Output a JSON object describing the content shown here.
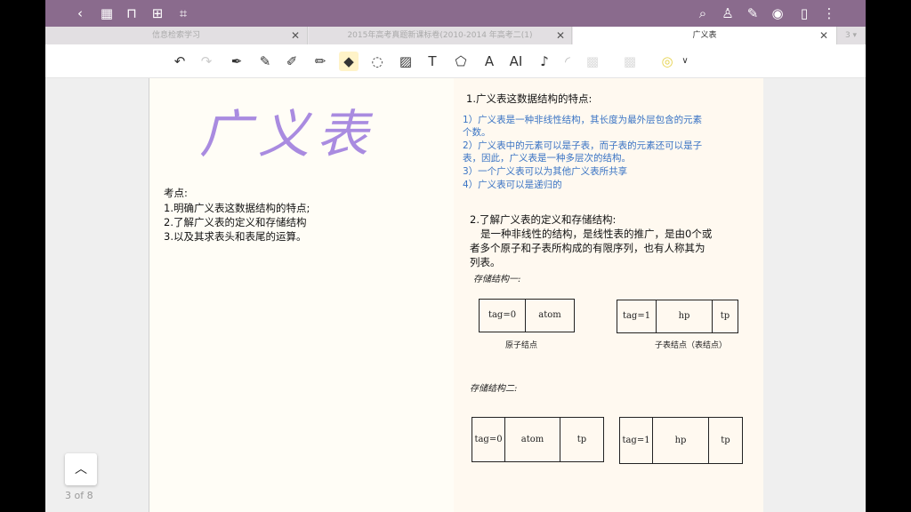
{
  "tabs": [
    {
      "label": "信息检索学习"
    },
    {
      "label": "2015年高考真题新课标卷(2010-2014 年高考二(1)"
    },
    {
      "label": "广义表"
    },
    {
      "label": "3"
    }
  ],
  "page_indicator": "3 of 8",
  "left_page": {
    "handwritten_title": "广义表",
    "notes_heading": "考点:",
    "notes": [
      "1.明确广义表这数据结构的特点;",
      "2.了解广义表的定义和存储结构",
      "3.以及其求表头和表尾的运算。"
    ]
  },
  "right_page": {
    "section1_title": "1.广义表这数据结构的特点:",
    "points": [
      "1）广义表是一种非线性结构，其长度为最外层包含的元素",
      "个数。",
      "2）广义表中的元素可以是子表，而子表的元素还可以是子",
      "表，因此，广义表是一种多层次的结构。",
      "3）一个广义表可以为其他广义表所共享",
      "4）广义表可以是递归的"
    ],
    "section2_title": "2.了解广义表的定义和存储结构:",
    "definition": [
      "是一种非线性的结构，是线性表的推广，是由0个或",
      "者多个原子和子表所构成的有限序列，也有人称其为",
      "列表。"
    ],
    "storage1_label": "存储结构一:",
    "storage1_atom_cells": [
      "tag=0",
      "atom"
    ],
    "storage1_atom_caption": "原子结点",
    "storage1_sub_cells": [
      "tag=1",
      "hp",
      "tp"
    ],
    "storage1_sub_caption": "子表结点（表结点）",
    "storage2_label": "存储结构二:",
    "storage2_atom_cells": [
      "tag=0",
      "atom",
      "tp"
    ],
    "storage2_sub_cells": [
      "tag=1",
      "hp",
      "tp"
    ]
  },
  "colors": {
    "topbar": "#8a6b8d",
    "handwriting": "#a98be0",
    "point_text": "#3a74c4"
  }
}
